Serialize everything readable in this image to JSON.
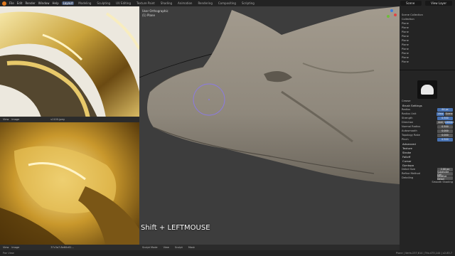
{
  "topbar": {
    "menus": [
      "File",
      "Edit",
      "Render",
      "Window",
      "Help"
    ],
    "workspaces": [
      "Layout",
      "Modeling",
      "Sculpting",
      "UV Editing",
      "Texture Paint",
      "Shading",
      "Animation",
      "Rendering",
      "Compositing",
      "Scripting"
    ],
    "active_workspace": "Layout",
    "scene": "Scene",
    "view_layer": "View Layer"
  },
  "ref_top": {
    "view": "View",
    "image": "Image",
    "file": "s1100.jpeg"
  },
  "ref_bottom": {
    "view": "View",
    "image": "Image",
    "file": "37c3a7.8e60c61..."
  },
  "viewport": {
    "view_name": "User Orthographic",
    "object": "(1) Plane",
    "mode": "Sculpt Mode",
    "menus": [
      "View",
      "Sculpt",
      "Mask"
    ],
    "keys_overlay": "Shift + LEFTMOUSE"
  },
  "outliner": {
    "title": "Scene Collection",
    "items": [
      "Collection",
      "Plane",
      "Plane",
      "Plane",
      "Plane",
      "Plane",
      "Plane",
      "Plane",
      "Plane",
      "Plane",
      "Plane"
    ]
  },
  "props": {
    "brush": "Crease",
    "brush_settings": "Brush Settings",
    "radius_label": "Radius",
    "radius": "64 px",
    "radius_unit_label": "Radius Unit",
    "radius_unit_view": "View",
    "radius_unit_scene": "Scene",
    "strength_label": "Strength",
    "strength": "0.500",
    "direction_label": "Direction",
    "dir_add": "Add",
    "dir_sub": "Subtract",
    "normal_radius_label": "Normal Radius",
    "normal_radius": "0.500",
    "autosmooth_label": "Autosmooth",
    "autosmooth": "0.000",
    "topology_rake_label": "Topology Rake",
    "topology_rake": "0.000",
    "pinch_label": "Pinch",
    "pinch": "0.500",
    "sections": [
      "Advanced",
      "Texture",
      "Stroke",
      "Falloff",
      "Cursor"
    ],
    "dyntopo": "Dyntopo",
    "detail_size_label": "Detail Size",
    "detail_size": "2.00 px",
    "refine_label": "Refine Method",
    "refine": "Subdivide Coll.",
    "detailing_label": "Detailing",
    "detailing": "Relative Detail",
    "smooth_shading": "Smooth Shading"
  },
  "status": {
    "left": "Pan View",
    "right": "Plane | Verts:237,614 | Tris:475,144 | v2.83.7"
  },
  "colors": {
    "accent": "#4772b3",
    "brush_circle": "#8c7be0",
    "gold": "#c9a23a",
    "sculpt": "#8f887c"
  }
}
